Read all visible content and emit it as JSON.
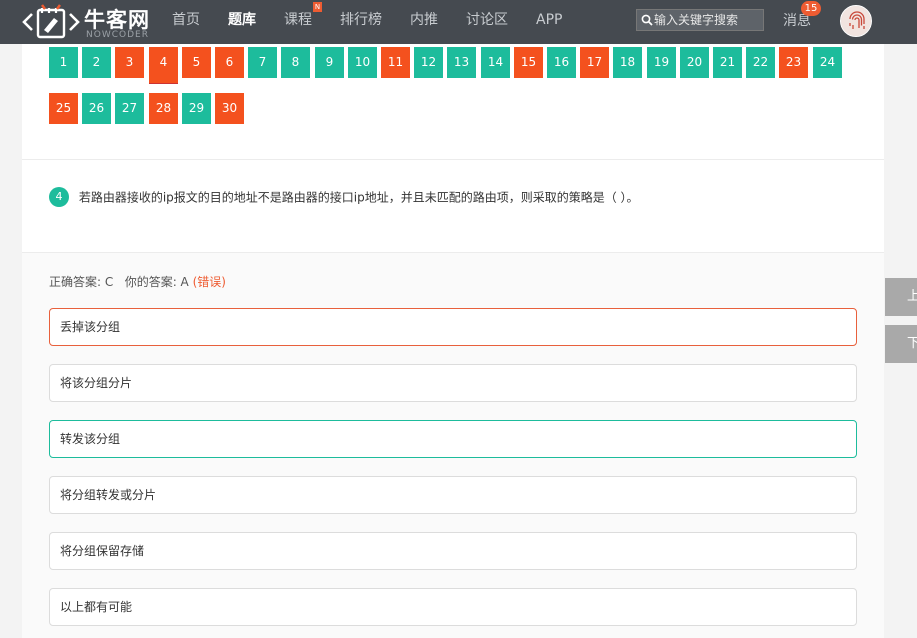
{
  "header": {
    "logo_text": "牛客网",
    "logo_sub": "NOWCODER",
    "nav": [
      {
        "label": "首页",
        "active": false,
        "badge": ""
      },
      {
        "label": "题库",
        "active": true,
        "badge": ""
      },
      {
        "label": "课程",
        "active": false,
        "badge": "N"
      },
      {
        "label": "排行榜",
        "active": false,
        "badge": ""
      },
      {
        "label": "内推",
        "active": false,
        "badge": ""
      },
      {
        "label": "讨论区",
        "active": false,
        "badge": ""
      },
      {
        "label": "APP",
        "active": false,
        "badge": ""
      }
    ],
    "search_placeholder": "输入关键字搜索",
    "messages_label": "消息",
    "messages_count": "15"
  },
  "question_nav": {
    "numbers": [
      {
        "n": "1",
        "status": "right"
      },
      {
        "n": "2",
        "status": "right"
      },
      {
        "n": "3",
        "status": "wrong"
      },
      {
        "n": "4",
        "status": "wrong",
        "current": true
      },
      {
        "n": "5",
        "status": "wrong"
      },
      {
        "n": "6",
        "status": "wrong"
      },
      {
        "n": "7",
        "status": "right"
      },
      {
        "n": "8",
        "status": "right"
      },
      {
        "n": "9",
        "status": "right"
      },
      {
        "n": "10",
        "status": "right"
      },
      {
        "n": "11",
        "status": "wrong"
      },
      {
        "n": "12",
        "status": "right"
      },
      {
        "n": "13",
        "status": "right"
      },
      {
        "n": "14",
        "status": "right"
      },
      {
        "n": "15",
        "status": "wrong"
      },
      {
        "n": "16",
        "status": "right"
      },
      {
        "n": "17",
        "status": "wrong"
      },
      {
        "n": "18",
        "status": "right"
      },
      {
        "n": "19",
        "status": "right"
      },
      {
        "n": "20",
        "status": "right"
      },
      {
        "n": "21",
        "status": "right"
      },
      {
        "n": "22",
        "status": "right"
      },
      {
        "n": "23",
        "status": "wrong"
      },
      {
        "n": "24",
        "status": "right"
      },
      {
        "n": "25",
        "status": "wrong"
      },
      {
        "n": "26",
        "status": "right"
      },
      {
        "n": "27",
        "status": "right"
      },
      {
        "n": "28",
        "status": "wrong"
      },
      {
        "n": "29",
        "status": "right"
      },
      {
        "n": "30",
        "status": "wrong"
      }
    ]
  },
  "question": {
    "number": "4",
    "stem": "若路由器接收的ip报文的目的地址不是路由器的接口ip地址，并且未匹配的路由项，则采取的策略是（ ）。"
  },
  "answer": {
    "correct_label": "正确答案: C",
    "your_label": "你的答案: A",
    "result": "(错误)",
    "options": [
      {
        "text": "丢掉该分组",
        "state": "wrong-sel"
      },
      {
        "text": "将该分组分片",
        "state": ""
      },
      {
        "text": "转发该分组",
        "state": "correct"
      },
      {
        "text": "将分组转发或分片",
        "state": ""
      },
      {
        "text": "将分组保留存储",
        "state": ""
      },
      {
        "text": "以上都有可能",
        "state": ""
      }
    ]
  },
  "side": {
    "prev": "上",
    "next": "下"
  },
  "colors": {
    "right": "#1dbc9c",
    "wrong": "#f4511e",
    "header": "#454a50"
  }
}
